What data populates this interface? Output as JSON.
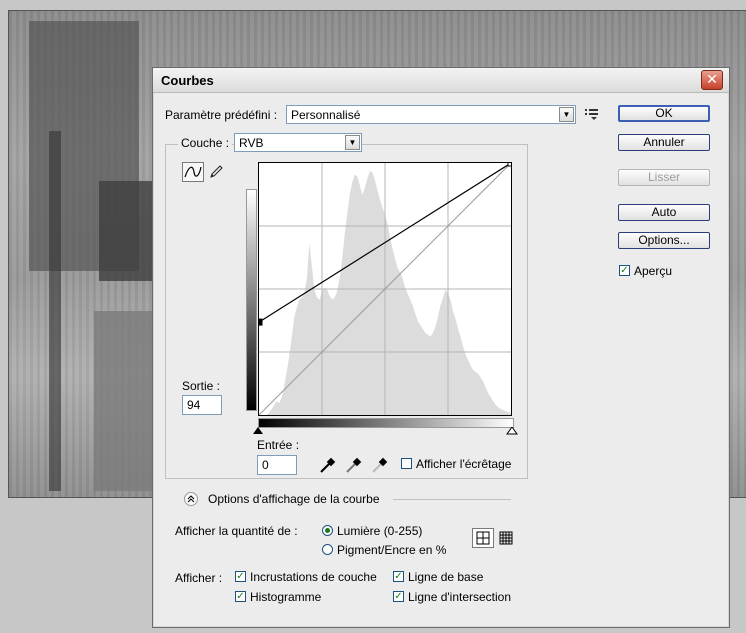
{
  "dialog": {
    "title": "Courbes",
    "close_glyph": "✕",
    "preset_label": "Paramètre prédéfini :",
    "preset_value": "Personnalisé",
    "channel_label": "Couche :",
    "channel_value": "RVB",
    "output_label": "Sortie :",
    "output_value": "94",
    "input_label": "Entrée :",
    "input_value": "0",
    "show_clipping_label": "Afficher l'écrêtage",
    "display_options_label": "Options d'affichage de la courbe",
    "show_amount_label": "Afficher la quantité de :",
    "light_label": "Lumière (0-255)",
    "pigment_label": "Pigment/Encre en %",
    "show_label": "Afficher :",
    "channel_overlays_label": "Incrustations de couche",
    "baseline_label": "Ligne de base",
    "histogram_label": "Histogramme",
    "intersection_label": "Ligne d'intersection",
    "preview_label": "Aperçu"
  },
  "buttons": {
    "ok": "OK",
    "cancel": "Annuler",
    "smooth": "Lisser",
    "auto": "Auto",
    "options": "Options..."
  },
  "states": {
    "preview_checked": true,
    "show_clipping_checked": false,
    "light_selected": true,
    "pigment_selected": false,
    "channel_overlays_checked": true,
    "baseline_checked": true,
    "histogram_checked": true,
    "intersection_checked": true
  },
  "curve": {
    "points": [
      [
        0,
        94
      ],
      [
        255,
        255
      ]
    ]
  },
  "histogram": {
    "levels": [
      0,
      0,
      0,
      0,
      2,
      6,
      10,
      14,
      12,
      18,
      30,
      44,
      60,
      80,
      100,
      110,
      118,
      120,
      125,
      140,
      176,
      152,
      128,
      120,
      118,
      126,
      130,
      128,
      122,
      118,
      120,
      126,
      140,
      160,
      185,
      205,
      225,
      238,
      246,
      244,
      235,
      225,
      232,
      242,
      250,
      248,
      240,
      230,
      220,
      212,
      205,
      196,
      182,
      170,
      160,
      150,
      146,
      140,
      130,
      124,
      118,
      112,
      104,
      96,
      92,
      88,
      84,
      82,
      80,
      84,
      90,
      100,
      112,
      120,
      128,
      124,
      118,
      106,
      98,
      88,
      80,
      70,
      62,
      56,
      50,
      46,
      44,
      42,
      38,
      34,
      28,
      22,
      18,
      14,
      10,
      8,
      6,
      5,
      4,
      3,
      2
    ]
  },
  "icons": {
    "curve_tool": "curve-point-icon",
    "pencil_tool": "pencil-icon",
    "preset_menu": "preset-menu-icon",
    "eyedroppers": [
      "black-eyedropper-icon",
      "gray-eyedropper-icon",
      "white-eyedropper-icon"
    ],
    "expand": "double-chevron-up-icon",
    "grid_simple": "grid-4x4-icon",
    "grid_detailed": "grid-10x10-icon"
  },
  "colors": {
    "check_mark": "#1a7a1a",
    "button_border": "#2c3e78",
    "dialog_bg": "#ececec"
  }
}
